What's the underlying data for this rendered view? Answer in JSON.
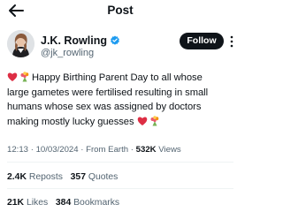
{
  "header": {
    "title": "Post",
    "back_icon": "arrow-left-icon"
  },
  "author": {
    "name": "J.K. Rowling",
    "handle": "@jk_rowling",
    "verified_icon": "verified-badge-icon",
    "verified_color": "#1d9bf0",
    "follow_label": "Follow",
    "more_icon": "more-vertical-icon"
  },
  "tweet": {
    "lines": [
      "Happy Birthing Parent Day to all whose",
      "large gametes were fertilised resulting in small",
      "humans whose sex was assigned by doctors",
      "making mostly lucky guesses"
    ],
    "emojis": [
      "red-heart-emoji",
      "bouquet-emoji"
    ]
  },
  "meta": {
    "time": "12:13",
    "date": "10/03/2024",
    "source": "From Earth",
    "views_count": "532K",
    "views_label": "Views",
    "separator": "·"
  },
  "stats": {
    "reposts_count": "2.4K",
    "reposts_label": "Reposts",
    "quotes_count": "357",
    "quotes_label": "Quotes",
    "likes_count": "21K",
    "likes_label": "Likes",
    "bookmarks_count": "384",
    "bookmarks_label": "Bookmarks"
  },
  "colors": {
    "text": "#0f1419",
    "secondary": "#536471",
    "divider": "#eff3f4",
    "follow_bg": "#0f1419"
  }
}
